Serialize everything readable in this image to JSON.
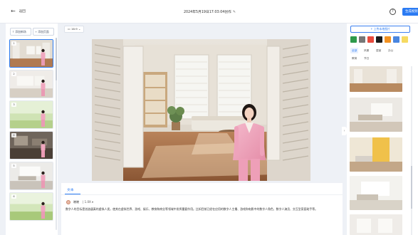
{
  "header": {
    "back_label": "返回",
    "title": "2024年5月19日17:03:04创作",
    "generate_label": "生成视频",
    "help_glyph": "?"
  },
  "left_panel": {
    "add_scene_label": "添加新场",
    "add_page_label": "添加页面",
    "scenes": [
      {
        "number": "1"
      },
      {
        "number": "2"
      },
      {
        "number": "3"
      },
      {
        "number": "4"
      },
      {
        "number": "5"
      },
      {
        "number": "6"
      }
    ]
  },
  "canvas": {
    "aspect_ratio": "16:9"
  },
  "script_panel": {
    "tab_label": "文本",
    "voice_name": "晓晓",
    "speed": "1.0",
    "paragraph": "数字人的目标是创造逼真的虚拟人类，使其在虚拟世界、游戏、娱乐、教育和商业等领域中发挥重要作用。比如目前已经在应用的数字人主播、游戏和电影中的数字人角色、数字人演员、交互型家庭助手等。"
  },
  "right_panel": {
    "upload_label": "上传本地图片",
    "swatch_colors": [
      "#2e9a4b",
      "#777777",
      "#e84a3d",
      "#1a1a1a",
      "#f29222",
      "#4a86e0",
      "#f6da62"
    ],
    "categories": [
      "全部",
      "风景",
      "居室",
      "办公",
      "教育",
      "节日"
    ]
  },
  "theme": {
    "accent": "#2b7bf3",
    "outfit": "#f0a7bf"
  }
}
